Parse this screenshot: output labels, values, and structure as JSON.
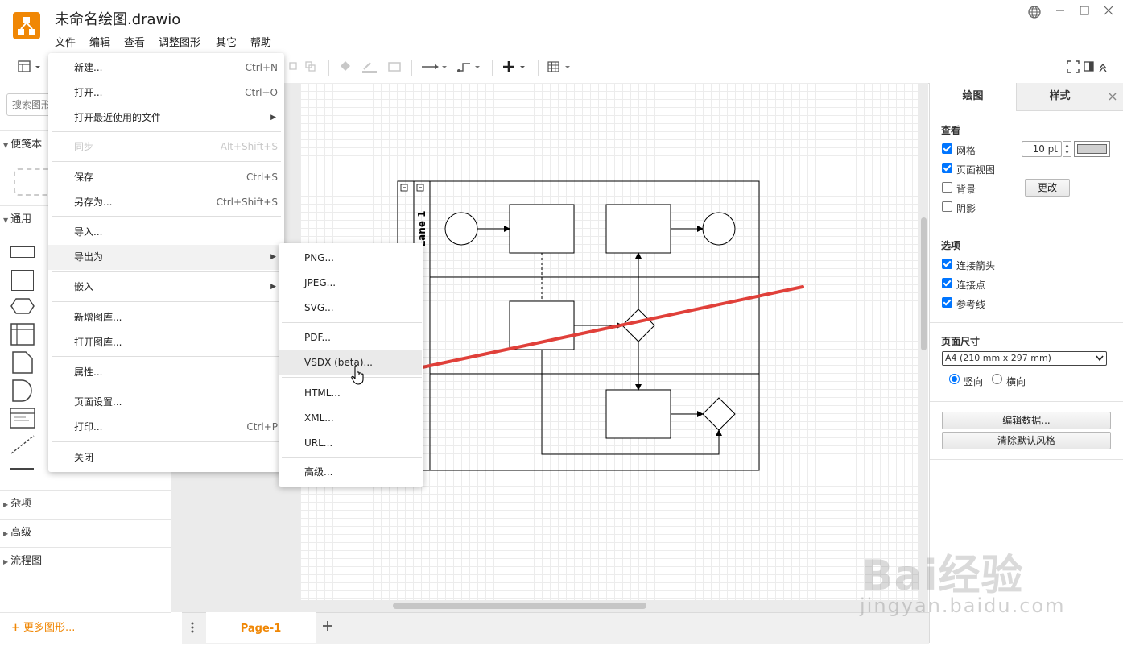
{
  "app": {
    "title": "未命名绘图.drawio",
    "menubar": [
      "文件",
      "编辑",
      "查看",
      "调整图形",
      "其它",
      "帮助"
    ],
    "brand_color": "#f08705"
  },
  "sidebar": {
    "search_placeholder": "搜索图形",
    "sections": {
      "scratchpad": "便笺本",
      "general": "通用",
      "misc": "杂项",
      "advanced": "高级",
      "flowchart": "流程图"
    },
    "more_shapes": "更多图形..."
  },
  "diagram": {
    "lane_label": "Lane 1"
  },
  "file_menu": {
    "items": [
      {
        "label": "新建...",
        "shortcut": "Ctrl+N"
      },
      {
        "label": "打开...",
        "shortcut": "Ctrl+O"
      },
      {
        "label": "打开最近使用的文件",
        "shortcut": ""
      },
      {
        "label": "同步",
        "shortcut": "Alt+Shift+S",
        "disabled": true
      },
      {
        "label": "保存",
        "shortcut": "Ctrl+S"
      },
      {
        "label": "另存为...",
        "shortcut": "Ctrl+Shift+S"
      },
      {
        "label": "导入...",
        "shortcut": ""
      },
      {
        "label": "导出为",
        "shortcut": ""
      },
      {
        "label": "嵌入",
        "shortcut": ""
      },
      {
        "label": "新增图库...",
        "shortcut": ""
      },
      {
        "label": "打开图库...",
        "shortcut": ""
      },
      {
        "label": "属性...",
        "shortcut": ""
      },
      {
        "label": "页面设置...",
        "shortcut": ""
      },
      {
        "label": "打印...",
        "shortcut": "Ctrl+P"
      },
      {
        "label": "关闭",
        "shortcut": ""
      }
    ]
  },
  "export_menu": {
    "items": [
      "PNG...",
      "JPEG...",
      "SVG...",
      "PDF...",
      "VSDX (beta)...",
      "HTML...",
      "XML...",
      "URL...",
      "高级..."
    ],
    "highlighted": "VSDX (beta)..."
  },
  "right_panel": {
    "tabs": [
      "绘图",
      "样式"
    ],
    "view_title": "查看",
    "grid_label": "网格",
    "grid_size": "10 pt",
    "page_view_label": "页面视图",
    "background_label": "背景",
    "change_button": "更改",
    "shadow_label": "阴影",
    "options_title": "选项",
    "connection_arrows": "连接箭头",
    "connection_points": "连接点",
    "guides": "参考线",
    "page_size_title": "页面尺寸",
    "page_size_value": "A4 (210 mm x 297 mm)",
    "portrait": "竖向",
    "landscape": "横向",
    "edit_data_button": "编辑数据...",
    "clear_style_button": "清除默认风格"
  },
  "pages": {
    "current": "Page-1"
  },
  "watermark": {
    "brand": "Bai经验",
    "url": "jingyan.baidu.com"
  }
}
